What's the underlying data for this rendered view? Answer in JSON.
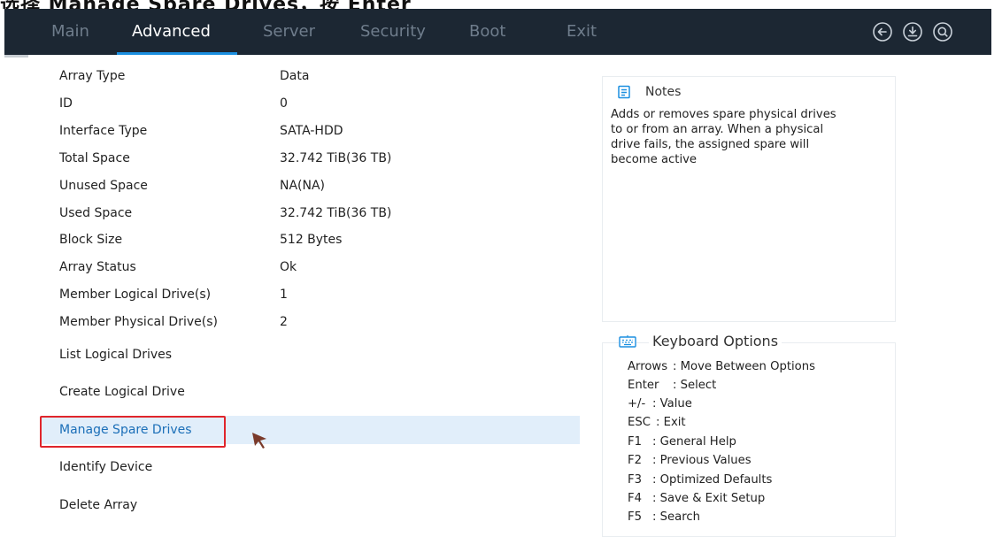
{
  "clipped_caption": "选择 Manage Spare Drives，按 Enter",
  "menu": {
    "tabs": [
      "Main",
      "Advanced",
      "Server",
      "Security",
      "Boot",
      "Exit"
    ],
    "active_tab": "Advanced",
    "icons": [
      "back-arrow-icon",
      "download-icon",
      "search-icon"
    ]
  },
  "details": [
    {
      "label": "Array Type",
      "value": "Data"
    },
    {
      "label": "ID",
      "value": "0"
    },
    {
      "label": "Interface Type",
      "value": "SATA-HDD"
    },
    {
      "label": "Total Space",
      "value": "32.742 TiB(36 TB)"
    },
    {
      "label": "Unused Space",
      "value": "NA(NA)"
    },
    {
      "label": "Used Space",
      "value": "32.742 TiB(36 TB)"
    },
    {
      "label": "Block Size",
      "value": "512 Bytes"
    },
    {
      "label": "Array Status",
      "value": "Ok"
    },
    {
      "label": "Member Logical Drive(s)",
      "value": "1"
    },
    {
      "label": "Member Physical Drive(s)",
      "value": "2"
    }
  ],
  "actions": [
    "List Logical Drives",
    "Create Logical Drive",
    "Manage Spare Drives",
    "Identify Device",
    "Delete Array"
  ],
  "selected_action": "Manage Spare Drives",
  "notes": {
    "title": "Notes",
    "lines": [
      "Adds or removes spare physical drives",
      "to or from an array. When a physical",
      "drive fails, the assigned spare will",
      "become active"
    ]
  },
  "keyboard": {
    "title": "Keyboard Options",
    "options": [
      {
        "key": "Arrows",
        "desc": ": Move Between Options"
      },
      {
        "key": "Enter",
        "desc": ": Select"
      },
      {
        "key": "+/-",
        "desc": ": Value"
      },
      {
        "key": "ESC",
        "desc": ": Exit"
      },
      {
        "key": "F1",
        "desc": ": General Help"
      },
      {
        "key": "F2",
        "desc": ": Previous Values"
      },
      {
        "key": "F3",
        "desc": ": Optimized Defaults"
      },
      {
        "key": "F4",
        "desc": ": Save & Exit Setup"
      },
      {
        "key": "F5",
        "desc": ": Search"
      }
    ]
  },
  "colors": {
    "menubar_bg": "#1c2733",
    "tab_inactive": "#6f7d8c",
    "tab_active": "#ffffff",
    "accent": "#1b8fe0",
    "selection_bg": "#e1eefa",
    "selected_text": "#1b6fb8",
    "annotation_red": "#e0252b"
  }
}
